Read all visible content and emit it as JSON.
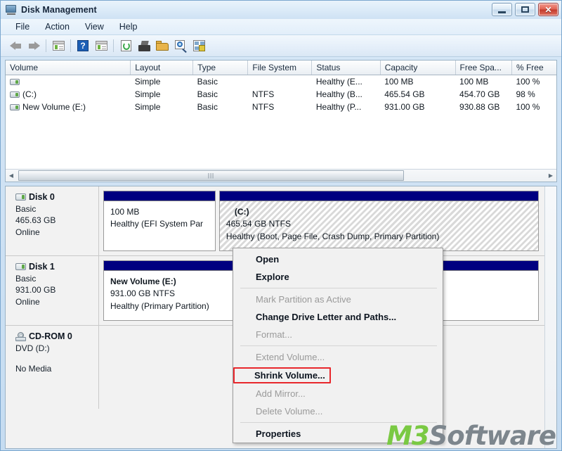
{
  "window": {
    "title": "Disk Management",
    "icon": "disk-management-icon",
    "buttons": {
      "minimize": "minimize",
      "maximize": "maximize",
      "close": "close"
    }
  },
  "menubar": {
    "items": [
      {
        "label": "File"
      },
      {
        "label": "Action"
      },
      {
        "label": "View"
      },
      {
        "label": "Help"
      }
    ]
  },
  "toolbar": {
    "buttons": [
      {
        "name": "back-arrow-icon",
        "label": "Back"
      },
      {
        "name": "forward-arrow-icon",
        "label": "Forward"
      },
      {
        "name": "show-hide-console-tree-icon",
        "label": "Show/Hide Console Tree"
      },
      {
        "name": "help-icon",
        "label": "Help"
      },
      {
        "name": "show-hide-action-pane-icon",
        "label": "Show/Hide Action Pane"
      },
      {
        "name": "refresh-icon",
        "label": "Refresh"
      },
      {
        "name": "rescan-disks-icon",
        "label": "Rescan Disks"
      },
      {
        "name": "open-folder-icon",
        "label": "Open"
      },
      {
        "name": "properties-magnifier-icon",
        "label": "Properties"
      },
      {
        "name": "all-tasks-icon",
        "label": "All Tasks"
      }
    ]
  },
  "volume_list": {
    "columns": [
      "Volume",
      "Layout",
      "Type",
      "File System",
      "Status",
      "Capacity",
      "Free Spa...",
      "% Free"
    ],
    "rows": [
      {
        "volume": "",
        "icon": "drive-icon",
        "layout": "Simple",
        "type": "Basic",
        "file_system": "",
        "status": "Healthy (E...",
        "capacity": "100 MB",
        "free_space": "100 MB",
        "percent_free": "100 %"
      },
      {
        "volume": "(C:)",
        "icon": "drive-icon",
        "layout": "Simple",
        "type": "Basic",
        "file_system": "NTFS",
        "status": "Healthy (B...",
        "capacity": "465.54 GB",
        "free_space": "454.70 GB",
        "percent_free": "98 %"
      },
      {
        "volume": "New Volume (E:)",
        "icon": "drive-icon",
        "layout": "Simple",
        "type": "Basic",
        "file_system": "NTFS",
        "status": "Healthy (P...",
        "capacity": "931.00 GB",
        "free_space": "930.88 GB",
        "percent_free": "100 %"
      }
    ],
    "scrollbar": {
      "left_arrow": "◀",
      "right_arrow": "▶",
      "grip": "|||"
    }
  },
  "disk_pane": {
    "disks": [
      {
        "name": "Disk 0",
        "icon": "hard-disk-icon",
        "type": "Basic",
        "size": "465.63 GB",
        "status": "Online",
        "partitions": [
          {
            "label": "",
            "size_line": "100 MB",
            "status_line": "Healthy (EFI System Par",
            "selected": false,
            "width_pct": 26
          },
          {
            "label": "(C:)",
            "size_line": "465.54 GB NTFS",
            "status_line": "Healthy (Boot, Page File, Crash Dump, Primary Partition)",
            "selected": true,
            "width_pct": 74
          }
        ]
      },
      {
        "name": "Disk 1",
        "icon": "hard-disk-icon",
        "type": "Basic",
        "size": "931.00 GB",
        "status": "Online",
        "partitions": [
          {
            "label": "New Volume  (E:)",
            "size_line": "931.00 GB NTFS",
            "status_line": "Healthy (Primary Partition)",
            "selected": false,
            "width_pct": 100
          }
        ]
      },
      {
        "name": "CD-ROM 0",
        "icon": "cd-rom-icon",
        "type": "DVD (D:)",
        "size": "",
        "status": "No Media",
        "partitions": []
      }
    ]
  },
  "context_menu": {
    "items": [
      {
        "label": "Open",
        "bold": true,
        "disabled": false,
        "highlighted": false,
        "separator_after": false
      },
      {
        "label": "Explore",
        "bold": true,
        "disabled": false,
        "highlighted": false,
        "separator_after": true
      },
      {
        "label": "Mark Partition as Active",
        "bold": false,
        "disabled": true,
        "highlighted": false,
        "separator_after": false
      },
      {
        "label": "Change Drive Letter and Paths...",
        "bold": true,
        "disabled": false,
        "highlighted": false,
        "separator_after": false
      },
      {
        "label": "Format...",
        "bold": false,
        "disabled": true,
        "highlighted": false,
        "separator_after": true
      },
      {
        "label": "Extend Volume...",
        "bold": false,
        "disabled": true,
        "highlighted": false,
        "separator_after": false
      },
      {
        "label": "Shrink Volume...",
        "bold": true,
        "disabled": false,
        "highlighted": true,
        "separator_after": false
      },
      {
        "label": "Add Mirror...",
        "bold": false,
        "disabled": true,
        "highlighted": false,
        "separator_after": false
      },
      {
        "label": "Delete Volume...",
        "bold": false,
        "disabled": true,
        "highlighted": false,
        "separator_after": true
      },
      {
        "label": "Properties",
        "bold": true,
        "disabled": false,
        "highlighted": false,
        "separator_after": false
      }
    ],
    "highlight_color": "#e8272c"
  },
  "watermark": {
    "part1": "M3",
    "part2": "Software",
    "color1": "#7ac943",
    "color2": "#7d868d"
  },
  "colors": {
    "partition_bar": "#000080",
    "window_chrome": "#cfe2f4",
    "close_button": "#c23a2c"
  }
}
